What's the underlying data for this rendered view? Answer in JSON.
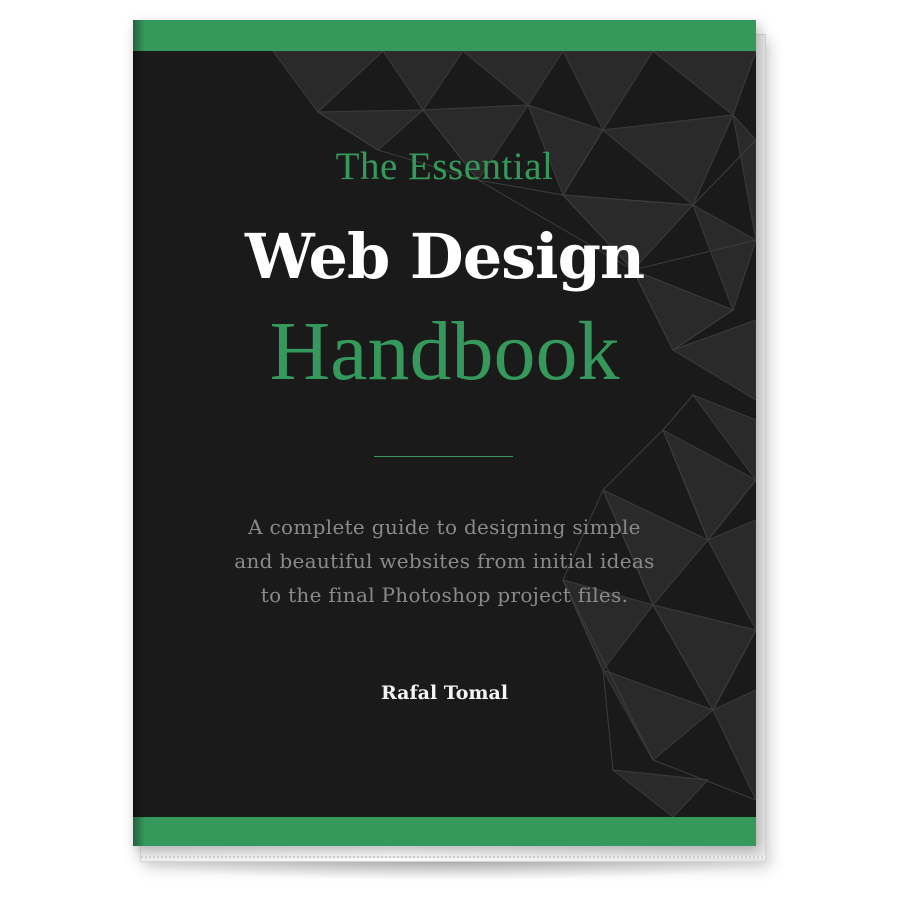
{
  "book": {
    "pre_title": "The Essential",
    "title": "Web Design",
    "subtitle": "Handbook",
    "description_lines": [
      "A complete guide to designing simple",
      "and beautiful websites from initial ideas",
      "to the final Photoshop project files."
    ],
    "author": "Rafal Tomal"
  },
  "colors": {
    "accent_green": "#35995c",
    "cover_background": "#1a1a1a",
    "title_white": "#ffffff",
    "description_gray": "#8a8a8a"
  },
  "icons": {
    "cover_pattern": "geometric-triangle-pattern"
  }
}
